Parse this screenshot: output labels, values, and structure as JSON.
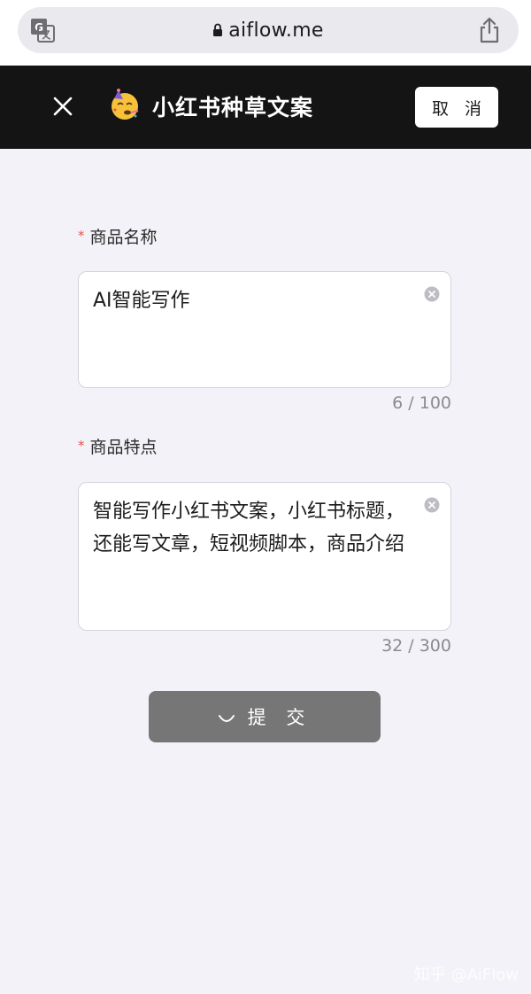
{
  "browser": {
    "url": "aiflow.me"
  },
  "header": {
    "title": "小红书种草文案",
    "cancel_label": "取 消"
  },
  "form": {
    "product_name": {
      "label": "商品名称",
      "value": "AI智能写作",
      "counter": "6 / 100"
    },
    "product_features": {
      "label": "商品特点",
      "value": "智能写作小红书文案，小红书标题，还能写文章，短视频脚本，商品介绍",
      "counter": "32 / 300"
    },
    "submit_label": "提 交"
  },
  "watermark": "知乎 @AiFlow",
  "colors": {
    "header_bg": "#141414",
    "page_bg": "#f2f2f8",
    "required_star": "#e5544b",
    "submit_bg": "#767676"
  }
}
